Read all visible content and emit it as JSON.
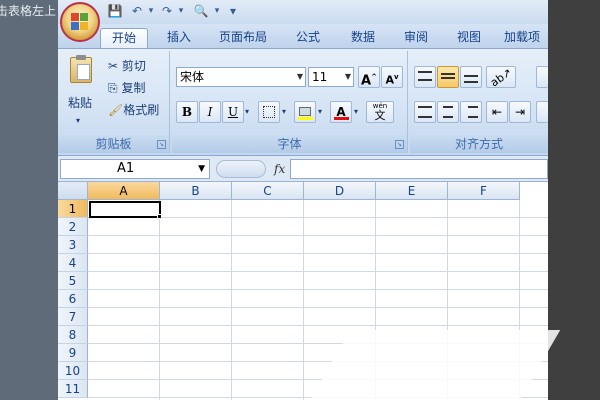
{
  "side_caption": "击表格左上",
  "quick_access": {
    "save": "💾",
    "undo": "↶",
    "redo": "↷",
    "preview": "🔍",
    "customize": "▾"
  },
  "tabs": [
    {
      "label": "开始",
      "active": true
    },
    {
      "label": "插入"
    },
    {
      "label": "页面布局"
    },
    {
      "label": "公式"
    },
    {
      "label": "数据"
    },
    {
      "label": "审阅"
    },
    {
      "label": "视图"
    },
    {
      "label": "加载项"
    }
  ],
  "clipboard": {
    "paste": "粘贴",
    "cut": "剪切",
    "copy": "复制",
    "format_painter": "格式刷",
    "group_label": "剪贴板"
  },
  "font": {
    "name": "宋体",
    "size": "11",
    "grow": "A",
    "shrink": "A",
    "bold": "B",
    "italic": "I",
    "underline": "U",
    "font_color_glyph": "A",
    "phonetic": "文",
    "phonetic_top": "wén",
    "group_label": "字体"
  },
  "alignment": {
    "group_label": "对齐方式"
  },
  "formula_bar": {
    "cell_ref": "A1",
    "fx": "fx",
    "value": ""
  },
  "columns": [
    "A",
    "B",
    "C",
    "D",
    "E",
    "F"
  ],
  "rows": [
    "1",
    "2",
    "3",
    "4",
    "5",
    "6",
    "7",
    "8",
    "9",
    "10",
    "11"
  ],
  "active_cell": "A1",
  "colors": {
    "selection": "#f1b95c",
    "brand_ring": "#b9324c",
    "ribbon": "#d4e3f4"
  }
}
